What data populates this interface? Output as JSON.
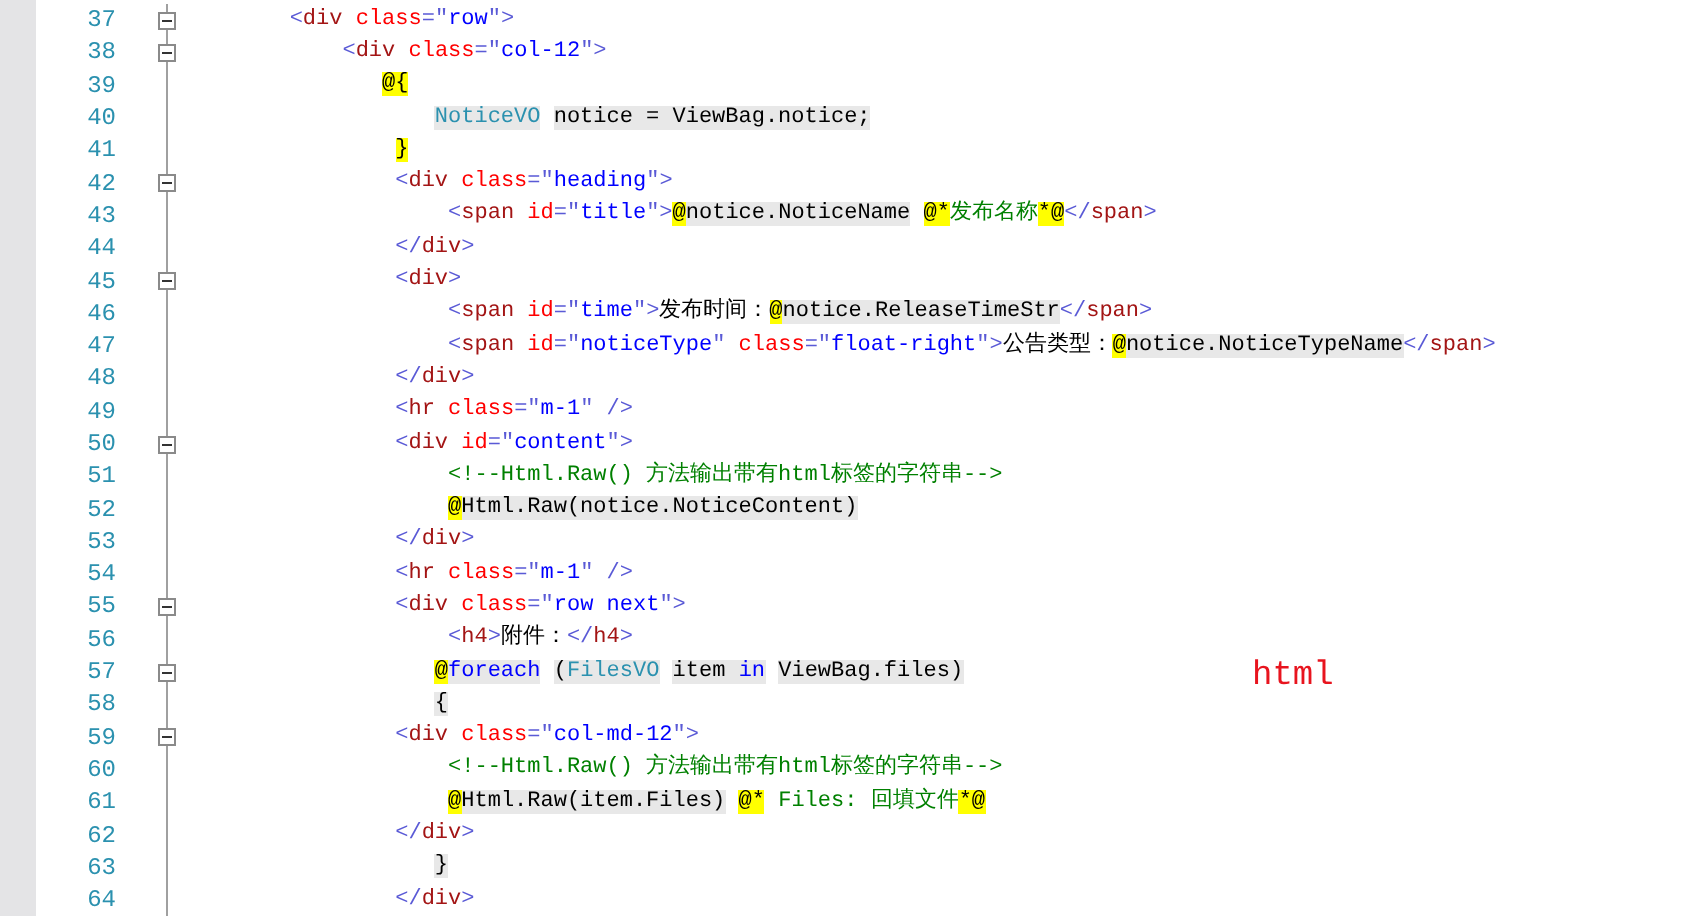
{
  "editor": {
    "lines": [
      {
        "number": "37",
        "fold": true,
        "tokens": [
          {
            "kind": "punct",
            "text": "        <"
          },
          {
            "kind": "tag",
            "text": "div"
          },
          {
            "kind": "attr",
            "text": " class"
          },
          {
            "kind": "punct",
            "text": "=\""
          },
          {
            "kind": "value",
            "text": "row"
          },
          {
            "kind": "punct",
            "text": "\">"
          }
        ]
      },
      {
        "number": "38",
        "fold": true,
        "tokens": [
          {
            "kind": "punct",
            "text": "            <"
          },
          {
            "kind": "tag",
            "text": "div"
          },
          {
            "kind": "attr",
            "text": " class"
          },
          {
            "kind": "punct",
            "text": "=\""
          },
          {
            "kind": "value",
            "text": "col-12"
          },
          {
            "kind": "punct",
            "text": "\">"
          }
        ]
      },
      {
        "number": "39",
        "fold": false,
        "tokens": [
          {
            "kind": "razor",
            "text": "               @{"
          }
        ]
      },
      {
        "number": "40",
        "fold": false,
        "tokens": [
          {
            "kind": "cstype",
            "text": "                   NoticeVO"
          },
          {
            "kind": "cs",
            "text": " notice = ViewBag.notice;"
          }
        ]
      },
      {
        "number": "41",
        "fold": false,
        "tokens": [
          {
            "kind": "razor",
            "text": "                }"
          }
        ]
      },
      {
        "number": "42",
        "fold": true,
        "tokens": [
          {
            "kind": "punct",
            "text": "                <"
          },
          {
            "kind": "tag",
            "text": "div"
          },
          {
            "kind": "attr",
            "text": " class"
          },
          {
            "kind": "punct",
            "text": "=\""
          },
          {
            "kind": "value",
            "text": "heading"
          },
          {
            "kind": "punct",
            "text": "\">"
          }
        ]
      },
      {
        "number": "43",
        "fold": false,
        "tokens": [
          {
            "kind": "punct",
            "text": "                    <"
          },
          {
            "kind": "tag",
            "text": "span"
          },
          {
            "kind": "attr",
            "text": " id"
          },
          {
            "kind": "punct",
            "text": "=\""
          },
          {
            "kind": "value",
            "text": "title"
          },
          {
            "kind": "punct",
            "text": "\">"
          },
          {
            "kind": "razor",
            "text": "@"
          },
          {
            "kind": "cs",
            "text": "notice.NoticeName"
          },
          {
            "kind": "razor",
            "text": " @*"
          },
          {
            "kind": "comment",
            "text": "发布名称"
          },
          {
            "kind": "razor",
            "text": "*@"
          },
          {
            "kind": "punct",
            "text": "</"
          },
          {
            "kind": "tag",
            "text": "span"
          },
          {
            "kind": "punct",
            "text": ">"
          }
        ]
      },
      {
        "number": "44",
        "fold": false,
        "tokens": [
          {
            "kind": "punct",
            "text": "                </"
          },
          {
            "kind": "tag",
            "text": "div"
          },
          {
            "kind": "punct",
            "text": ">"
          }
        ]
      },
      {
        "number": "45",
        "fold": true,
        "tokens": [
          {
            "kind": "punct",
            "text": "                <"
          },
          {
            "kind": "tag",
            "text": "div"
          },
          {
            "kind": "punct",
            "text": ">"
          }
        ]
      },
      {
        "number": "46",
        "fold": false,
        "tokens": [
          {
            "kind": "punct",
            "text": "                    <"
          },
          {
            "kind": "tag",
            "text": "span"
          },
          {
            "kind": "attr",
            "text": " id"
          },
          {
            "kind": "punct",
            "text": "=\""
          },
          {
            "kind": "value",
            "text": "time"
          },
          {
            "kind": "punct",
            "text": "\">"
          },
          {
            "kind": "plain",
            "text": "发布时间："
          },
          {
            "kind": "razor",
            "text": "@"
          },
          {
            "kind": "cs",
            "text": "notice.ReleaseTimeStr"
          },
          {
            "kind": "punct",
            "text": "</"
          },
          {
            "kind": "tag",
            "text": "span"
          },
          {
            "kind": "punct",
            "text": ">"
          }
        ]
      },
      {
        "number": "47",
        "fold": false,
        "tokens": [
          {
            "kind": "punct",
            "text": "                    <"
          },
          {
            "kind": "tag",
            "text": "span"
          },
          {
            "kind": "attr",
            "text": " id"
          },
          {
            "kind": "punct",
            "text": "=\""
          },
          {
            "kind": "value",
            "text": "noticeType"
          },
          {
            "kind": "punct",
            "text": "\""
          },
          {
            "kind": "attr",
            "text": " class"
          },
          {
            "kind": "punct",
            "text": "=\""
          },
          {
            "kind": "value",
            "text": "float-right"
          },
          {
            "kind": "punct",
            "text": "\">"
          },
          {
            "kind": "plain",
            "text": "公告类型："
          },
          {
            "kind": "razor",
            "text": "@"
          },
          {
            "kind": "cs",
            "text": "notice.NoticeTypeName"
          },
          {
            "kind": "punct",
            "text": "</"
          },
          {
            "kind": "tag",
            "text": "span"
          },
          {
            "kind": "punct",
            "text": ">"
          }
        ]
      },
      {
        "number": "48",
        "fold": false,
        "tokens": [
          {
            "kind": "punct",
            "text": "                </"
          },
          {
            "kind": "tag",
            "text": "div"
          },
          {
            "kind": "punct",
            "text": ">"
          }
        ]
      },
      {
        "number": "49",
        "fold": false,
        "tokens": [
          {
            "kind": "punct",
            "text": "                <"
          },
          {
            "kind": "tag",
            "text": "hr"
          },
          {
            "kind": "attr",
            "text": " class"
          },
          {
            "kind": "punct",
            "text": "=\""
          },
          {
            "kind": "value",
            "text": "m-1"
          },
          {
            "kind": "punct",
            "text": "\" />"
          }
        ]
      },
      {
        "number": "50",
        "fold": true,
        "tokens": [
          {
            "kind": "punct",
            "text": "                <"
          },
          {
            "kind": "tag",
            "text": "div"
          },
          {
            "kind": "attr",
            "text": " id"
          },
          {
            "kind": "punct",
            "text": "=\""
          },
          {
            "kind": "value",
            "text": "content"
          },
          {
            "kind": "punct",
            "text": "\">"
          }
        ]
      },
      {
        "number": "51",
        "fold": false,
        "tokens": [
          {
            "kind": "comment",
            "text": "                    <!--Html.Raw() 方法输出带有html标签的字符串-->"
          }
        ]
      },
      {
        "number": "52",
        "fold": false,
        "tokens": [
          {
            "kind": "razor",
            "text": "                    @"
          },
          {
            "kind": "cs",
            "text": "Html.Raw(notice.NoticeContent)"
          }
        ]
      },
      {
        "number": "53",
        "fold": false,
        "tokens": [
          {
            "kind": "punct",
            "text": "                </"
          },
          {
            "kind": "tag",
            "text": "div"
          },
          {
            "kind": "punct",
            "text": ">"
          }
        ]
      },
      {
        "number": "54",
        "fold": false,
        "tokens": [
          {
            "kind": "punct",
            "text": "                <"
          },
          {
            "kind": "tag",
            "text": "hr"
          },
          {
            "kind": "attr",
            "text": " class"
          },
          {
            "kind": "punct",
            "text": "=\""
          },
          {
            "kind": "value",
            "text": "m-1"
          },
          {
            "kind": "punct",
            "text": "\" />"
          }
        ]
      },
      {
        "number": "55",
        "fold": true,
        "tokens": [
          {
            "kind": "punct",
            "text": "                <"
          },
          {
            "kind": "tag",
            "text": "div"
          },
          {
            "kind": "attr",
            "text": " class"
          },
          {
            "kind": "punct",
            "text": "=\""
          },
          {
            "kind": "value",
            "text": "row next"
          },
          {
            "kind": "punct",
            "text": "\">"
          }
        ]
      },
      {
        "number": "56",
        "fold": false,
        "tokens": [
          {
            "kind": "punct",
            "text": "                    <"
          },
          {
            "kind": "tag",
            "text": "h4"
          },
          {
            "kind": "punct",
            "text": ">"
          },
          {
            "kind": "plain",
            "text": "附件："
          },
          {
            "kind": "punct",
            "text": "</"
          },
          {
            "kind": "tag",
            "text": "h4"
          },
          {
            "kind": "punct",
            "text": ">"
          }
        ]
      },
      {
        "number": "57",
        "fold": true,
        "tokens": [
          {
            "kind": "razor",
            "text": "                   @"
          },
          {
            "kind": "cskw",
            "text": "foreach"
          },
          {
            "kind": "cs",
            "text": " ("
          },
          {
            "kind": "cstype",
            "text": "FilesVO"
          },
          {
            "kind": "cs",
            "text": " item "
          },
          {
            "kind": "cskw",
            "text": "in"
          },
          {
            "kind": "cs",
            "text": " ViewBag.files)"
          }
        ]
      },
      {
        "number": "58",
        "fold": false,
        "tokens": [
          {
            "kind": "cs",
            "text": "                   {"
          }
        ]
      },
      {
        "number": "59",
        "fold": true,
        "tokens": [
          {
            "kind": "punct",
            "text": "                <"
          },
          {
            "kind": "tag",
            "text": "div"
          },
          {
            "kind": "attr",
            "text": " class"
          },
          {
            "kind": "punct",
            "text": "=\""
          },
          {
            "kind": "value",
            "text": "col-md-12"
          },
          {
            "kind": "punct",
            "text": "\">"
          }
        ]
      },
      {
        "number": "60",
        "fold": false,
        "tokens": [
          {
            "kind": "comment",
            "text": "                    <!--Html.Raw() 方法输出带有html标签的字符串-->"
          }
        ]
      },
      {
        "number": "61",
        "fold": false,
        "tokens": [
          {
            "kind": "razor",
            "text": "                    @"
          },
          {
            "kind": "cs",
            "text": "Html.Raw(item.Files)"
          },
          {
            "kind": "razor",
            "text": " @*"
          },
          {
            "kind": "comment",
            "text": " Files: 回填文件"
          },
          {
            "kind": "razor",
            "text": "*@"
          }
        ]
      },
      {
        "number": "62",
        "fold": false,
        "tokens": [
          {
            "kind": "punct",
            "text": "                </"
          },
          {
            "kind": "tag",
            "text": "div"
          },
          {
            "kind": "punct",
            "text": ">"
          }
        ]
      },
      {
        "number": "63",
        "fold": false,
        "tokens": [
          {
            "kind": "cs",
            "text": "                   }"
          }
        ]
      },
      {
        "number": "64",
        "fold": false,
        "tokens": [
          {
            "kind": "punct",
            "text": "                </"
          },
          {
            "kind": "tag",
            "text": "div"
          },
          {
            "kind": "punct",
            "text": ">"
          }
        ]
      }
    ]
  },
  "annotation": {
    "text": "html"
  }
}
